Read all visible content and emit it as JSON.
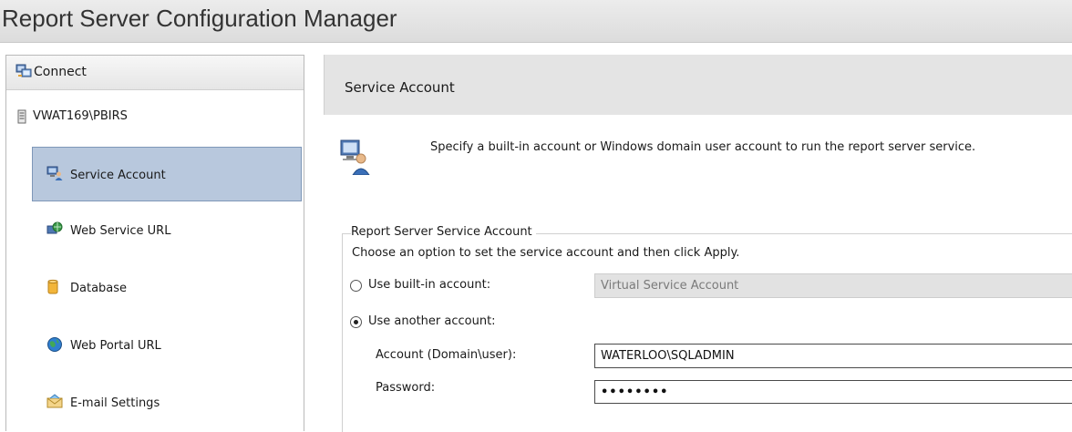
{
  "app": {
    "title": "Report Server Configuration Manager"
  },
  "sidebar": {
    "connect_label": "Connect",
    "server_name": "VWAT169\\PBIRS",
    "items": [
      {
        "label": "Service Account",
        "icon": "service-account-icon",
        "selected": true
      },
      {
        "label": "Web Service URL",
        "icon": "web-service-icon",
        "selected": false
      },
      {
        "label": "Database",
        "icon": "database-icon",
        "selected": false
      },
      {
        "label": "Web Portal URL",
        "icon": "globe-icon",
        "selected": false
      },
      {
        "label": "E-mail Settings",
        "icon": "email-icon",
        "selected": false
      }
    ]
  },
  "main": {
    "header": "Service Account",
    "intro": "Specify a built-in account or Windows domain user account to run the report server service.",
    "group": {
      "title": "Report Server Service Account",
      "description": "Choose an option to set the service account and then click Apply.",
      "builtin_label": "Use built-in account:",
      "builtin_value": "Virtual Service Account",
      "another_label": "Use another account:",
      "selected_option": "another",
      "account_label": "Account (Domain\\user):",
      "account_value": "WATERLOO\\SQLADMIN",
      "password_label": "Password:",
      "password_value": "••••••••"
    }
  },
  "colors": {
    "selected_bg": "#b8c8dd",
    "selected_border": "#7e97b8",
    "header_bg": "#e4e4e4"
  }
}
